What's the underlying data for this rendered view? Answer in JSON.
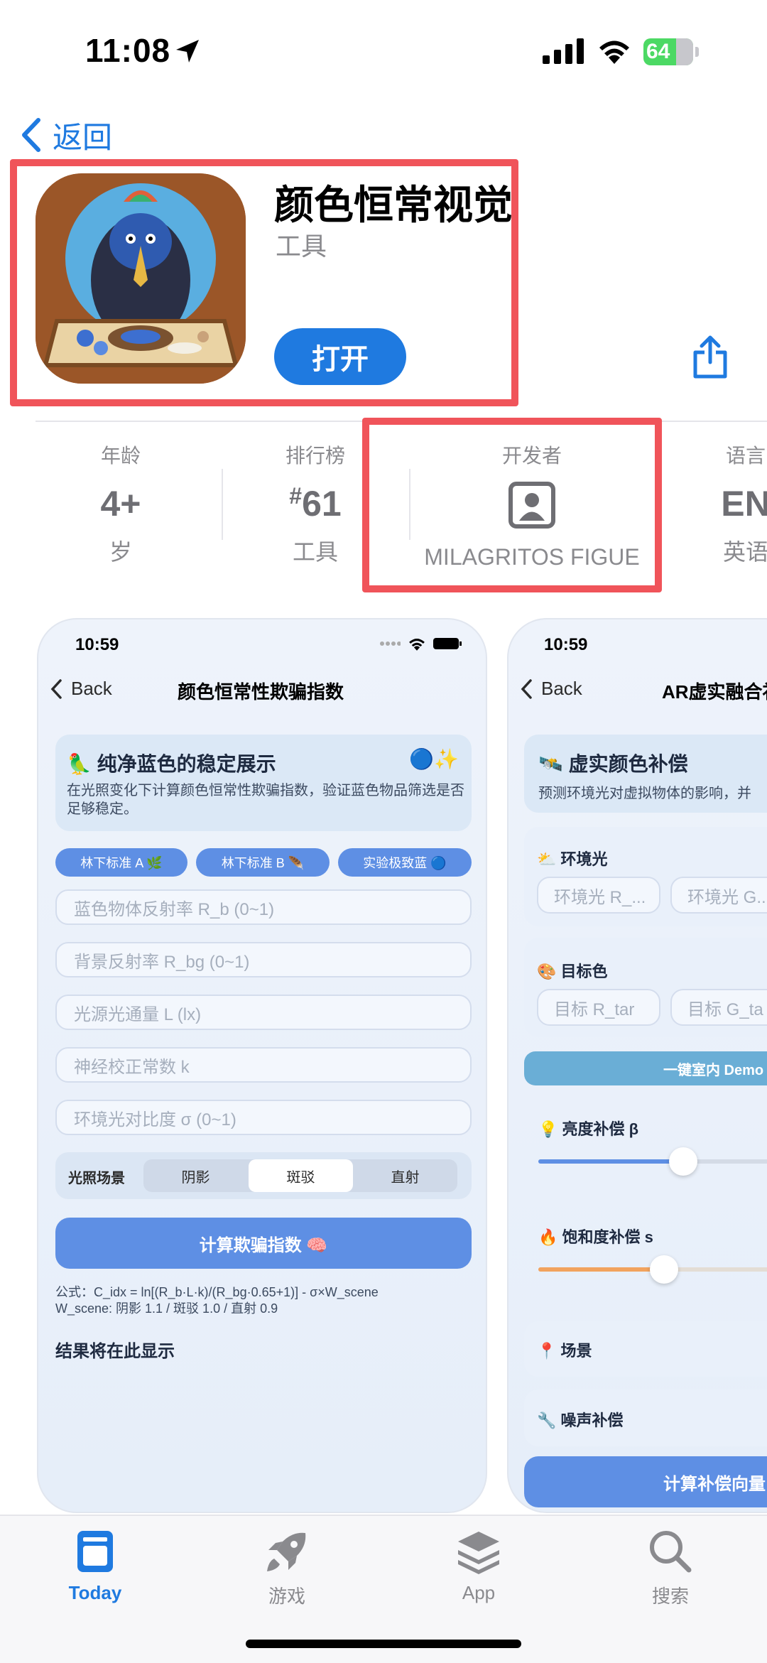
{
  "status_bar": {
    "time": "11:08",
    "battery": "64"
  },
  "nav": {
    "back_label": "返回"
  },
  "app": {
    "title": "颜色恒常视觉",
    "category": "工具",
    "open_button": "打开"
  },
  "info": {
    "age": {
      "label": "年龄",
      "value": "4+",
      "sub": "岁"
    },
    "chart": {
      "label": "排行榜",
      "value_prefix": "#",
      "value": "61",
      "sub": "工具"
    },
    "developer": {
      "label": "开发者",
      "sub": "MILAGRITOS FIGUE"
    },
    "language": {
      "label": "语言",
      "value": "EN",
      "sub": "英语"
    }
  },
  "screenshot1": {
    "time": "10:59",
    "back": "Back",
    "title": "颜色恒常性欺骗指数",
    "hero_title": "🦜 纯净蓝色的稳定展示",
    "hero_emoji": "🔵✨",
    "hero_desc": "在光照变化下计算颜色恒常性欺骗指数，验证蓝色物品筛选是否足够稳定。",
    "chips": [
      "林下标准 A 🌿",
      "林下标准 B 🪶",
      "实验极致蓝 🔵"
    ],
    "fields": [
      "蓝色物体反射率 R_b (0~1)",
      "背景反射率 R_bg (0~1)",
      "光源光通量 L (lx)",
      "神经校正常数 k",
      "环境光对比度 σ (0~1)"
    ],
    "scene_label": "光照场景",
    "scene_options": [
      "阴影",
      "斑驳",
      "直射"
    ],
    "calc_button": "计算欺骗指数 🧠",
    "formula_line1": "公式：C_idx = ln[(R_b·L·k)/(R_bg·0.65+1)] - σ×W_scene",
    "formula_line2": "W_scene: 阴影 1.1 / 斑驳 1.0 / 直射 0.9",
    "result": "结果将在此显示"
  },
  "screenshot2": {
    "time": "10:59",
    "back": "Back",
    "title": "AR虚实融合补",
    "hero_title": "🛰️ 虚实颜色补偿",
    "hero_desc": "预测环境光对虚拟物体的影响，并",
    "ambient_label": "⛅ 环境光",
    "ambient_fields": [
      "环境光 R_...",
      "环境光 G..."
    ],
    "target_label": "🎨 目标色",
    "target_fields": [
      "目标 R_tar",
      "目标 G_ta"
    ],
    "demo_button": "一键室内 Demo",
    "brightness_label": "💡 亮度补偿 β",
    "brightness_value": 0.6,
    "saturation_label": "🔥 饱和度补偿 s",
    "saturation_value": 0.52,
    "scene_label": "📍 场景",
    "noise_label": "🔧 噪声补偿",
    "calc_button": "计算补偿向量"
  },
  "tabs": [
    {
      "label": "Today",
      "icon": "today-icon",
      "active": true
    },
    {
      "label": "游戏",
      "icon": "rocket-icon",
      "active": false
    },
    {
      "label": "App",
      "icon": "app-stack-icon",
      "active": false
    },
    {
      "label": "搜索",
      "icon": "search-icon",
      "active": false
    }
  ],
  "colors": {
    "accent": "#1f7ae0",
    "highlight": "#f0545a",
    "chip": "#5e8fe4"
  }
}
